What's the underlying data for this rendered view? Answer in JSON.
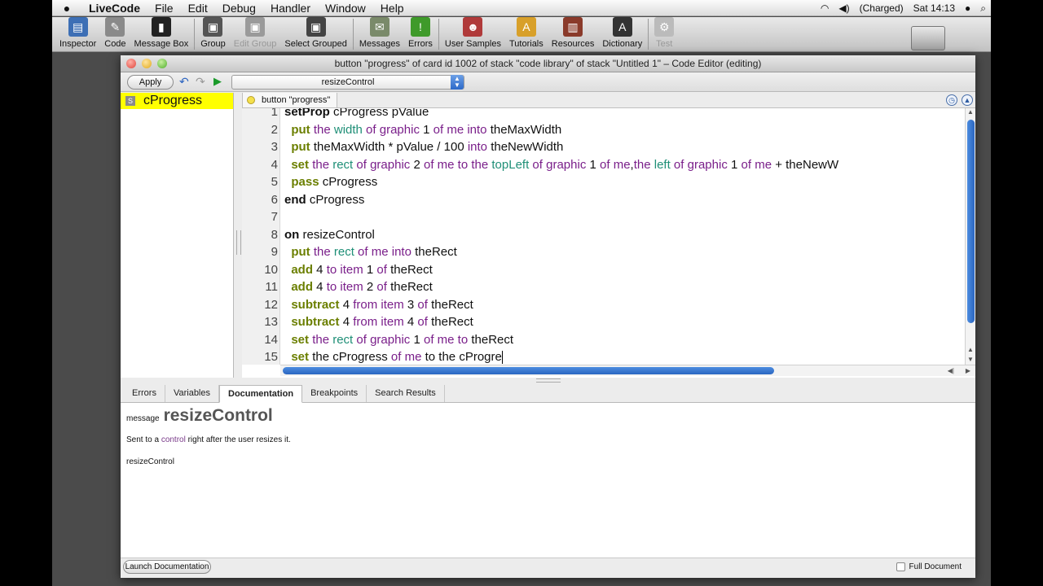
{
  "menubar": {
    "apple": "",
    "app_name": "LiveCode",
    "items": [
      "File",
      "Edit",
      "Debug",
      "Handler",
      "Window",
      "Help"
    ],
    "battery": "(Charged)",
    "clock": "Sat 14:13"
  },
  "toolbar": {
    "buttons": [
      {
        "label": "Inspector",
        "icon": "inspector-icon",
        "color": "#3d6fb5"
      },
      {
        "label": "Code",
        "icon": "code-icon",
        "color": "#8a8a8a"
      },
      {
        "label": "Message Box",
        "icon": "message-box-icon",
        "color": "#222222"
      },
      {
        "label": "Group",
        "icon": "group-icon",
        "color": "#555555"
      },
      {
        "label": "Edit Group",
        "icon": "edit-group-icon",
        "color": "#9a9a9a"
      },
      {
        "label": "Select Grouped",
        "icon": "select-grouped-icon",
        "color": "#444444"
      },
      {
        "label": "Messages",
        "icon": "messages-icon",
        "color": "#7a8a6a"
      },
      {
        "label": "Errors",
        "icon": "errors-icon",
        "color": "#3f9a2a"
      },
      {
        "label": "User Samples",
        "icon": "user-samples-icon",
        "color": "#b03a3a"
      },
      {
        "label": "Tutorials",
        "icon": "tutorials-icon",
        "color": "#d8a02a"
      },
      {
        "label": "Resources",
        "icon": "resources-icon",
        "color": "#8a3a2a"
      },
      {
        "label": "Dictionary",
        "icon": "dictionary-icon",
        "color": "#333333"
      },
      {
        "label": "Test",
        "icon": "test-icon",
        "color": "#bbbbbb"
      }
    ]
  },
  "window": {
    "title": "button \"progress\" of card id 1002 of stack \"code library\" of stack \"Untitled 1\" – Code Editor (editing)"
  },
  "editor": {
    "apply_label": "Apply",
    "handler_select": "resizeControl",
    "handlers": [
      {
        "badge": "S",
        "name": "cProgress"
      }
    ],
    "tab_label": "button \"progress\""
  },
  "code": {
    "line_numbers": [
      "1",
      "2",
      "3",
      "4",
      "5",
      "6",
      "7",
      "8",
      "9",
      "10",
      "11",
      "12",
      "13",
      "14",
      "15"
    ],
    "lines": [
      [
        {
          "t": "setProp",
          "c": "kwd"
        },
        {
          "t": " cProgress pValue",
          "c": ""
        }
      ],
      [
        {
          "t": "  ",
          "c": ""
        },
        {
          "t": "put",
          "c": "kw"
        },
        {
          "t": " the ",
          "c": "op"
        },
        {
          "t": "width",
          "c": "pr"
        },
        {
          "t": " of ",
          "c": "op"
        },
        {
          "t": "graphic",
          "c": "op"
        },
        {
          "t": " 1 ",
          "c": ""
        },
        {
          "t": "of",
          "c": "op"
        },
        {
          "t": " ",
          "c": ""
        },
        {
          "t": "me",
          "c": "op"
        },
        {
          "t": " ",
          "c": ""
        },
        {
          "t": "into",
          "c": "op"
        },
        {
          "t": " theMaxWidth",
          "c": ""
        }
      ],
      [
        {
          "t": "  ",
          "c": ""
        },
        {
          "t": "put",
          "c": "kw"
        },
        {
          "t": " theMaxWidth * pValue / 100 ",
          "c": ""
        },
        {
          "t": "into",
          "c": "op"
        },
        {
          "t": " theNewWidth",
          "c": ""
        }
      ],
      [
        {
          "t": "  ",
          "c": ""
        },
        {
          "t": "set",
          "c": "kw"
        },
        {
          "t": " the ",
          "c": "op"
        },
        {
          "t": "rect",
          "c": "pr"
        },
        {
          "t": " of ",
          "c": "op"
        },
        {
          "t": "graphic",
          "c": "op"
        },
        {
          "t": " 2 ",
          "c": ""
        },
        {
          "t": "of",
          "c": "op"
        },
        {
          "t": " ",
          "c": ""
        },
        {
          "t": "me",
          "c": "op"
        },
        {
          "t": " to the ",
          "c": "op"
        },
        {
          "t": "topLeft",
          "c": "pr"
        },
        {
          "t": " of ",
          "c": "op"
        },
        {
          "t": "graphic",
          "c": "op"
        },
        {
          "t": " 1 ",
          "c": ""
        },
        {
          "t": "of",
          "c": "op"
        },
        {
          "t": " ",
          "c": ""
        },
        {
          "t": "me",
          "c": "op"
        },
        {
          "t": ",",
          "c": ""
        },
        {
          "t": "the ",
          "c": "op"
        },
        {
          "t": "left",
          "c": "pr"
        },
        {
          "t": " of ",
          "c": "op"
        },
        {
          "t": "graphic",
          "c": "op"
        },
        {
          "t": " 1 ",
          "c": ""
        },
        {
          "t": "of",
          "c": "op"
        },
        {
          "t": " ",
          "c": ""
        },
        {
          "t": "me",
          "c": "op"
        },
        {
          "t": " + theNewW",
          "c": ""
        }
      ],
      [
        {
          "t": "  ",
          "c": ""
        },
        {
          "t": "pass",
          "c": "kw"
        },
        {
          "t": " cProgress",
          "c": ""
        }
      ],
      [
        {
          "t": "end",
          "c": "kwd"
        },
        {
          "t": " cProgress",
          "c": ""
        }
      ],
      [
        {
          "t": "",
          "c": ""
        }
      ],
      [
        {
          "t": "on",
          "c": "kwd"
        },
        {
          "t": " resizeControl",
          "c": ""
        }
      ],
      [
        {
          "t": "  ",
          "c": ""
        },
        {
          "t": "put",
          "c": "kw"
        },
        {
          "t": " the ",
          "c": "op"
        },
        {
          "t": "rect",
          "c": "pr"
        },
        {
          "t": " of ",
          "c": "op"
        },
        {
          "t": "me",
          "c": "op"
        },
        {
          "t": " ",
          "c": ""
        },
        {
          "t": "into",
          "c": "op"
        },
        {
          "t": " theRect",
          "c": ""
        }
      ],
      [
        {
          "t": "  ",
          "c": ""
        },
        {
          "t": "add",
          "c": "kw"
        },
        {
          "t": " 4 ",
          "c": ""
        },
        {
          "t": "to",
          "c": "op"
        },
        {
          "t": " ",
          "c": ""
        },
        {
          "t": "item",
          "c": "op"
        },
        {
          "t": " 1 ",
          "c": ""
        },
        {
          "t": "of",
          "c": "op"
        },
        {
          "t": " theRect",
          "c": ""
        }
      ],
      [
        {
          "t": "  ",
          "c": ""
        },
        {
          "t": "add",
          "c": "kw"
        },
        {
          "t": " 4 ",
          "c": ""
        },
        {
          "t": "to",
          "c": "op"
        },
        {
          "t": " ",
          "c": ""
        },
        {
          "t": "item",
          "c": "op"
        },
        {
          "t": " 2 ",
          "c": ""
        },
        {
          "t": "of",
          "c": "op"
        },
        {
          "t": " theRect",
          "c": ""
        }
      ],
      [
        {
          "t": "  ",
          "c": ""
        },
        {
          "t": "subtract",
          "c": "kw"
        },
        {
          "t": " 4 ",
          "c": ""
        },
        {
          "t": "from",
          "c": "op"
        },
        {
          "t": " ",
          "c": ""
        },
        {
          "t": "item",
          "c": "op"
        },
        {
          "t": " 3 ",
          "c": ""
        },
        {
          "t": "of",
          "c": "op"
        },
        {
          "t": " theRect",
          "c": ""
        }
      ],
      [
        {
          "t": "  ",
          "c": ""
        },
        {
          "t": "subtract",
          "c": "kw"
        },
        {
          "t": " 4 ",
          "c": ""
        },
        {
          "t": "from",
          "c": "op"
        },
        {
          "t": " ",
          "c": ""
        },
        {
          "t": "item",
          "c": "op"
        },
        {
          "t": " 4 ",
          "c": ""
        },
        {
          "t": "of",
          "c": "op"
        },
        {
          "t": " theRect",
          "c": ""
        }
      ],
      [
        {
          "t": "  ",
          "c": ""
        },
        {
          "t": "set",
          "c": "kw"
        },
        {
          "t": " the ",
          "c": "op"
        },
        {
          "t": "rect",
          "c": "pr"
        },
        {
          "t": " of ",
          "c": "op"
        },
        {
          "t": "graphic",
          "c": "op"
        },
        {
          "t": " 1 ",
          "c": ""
        },
        {
          "t": "of",
          "c": "op"
        },
        {
          "t": " ",
          "c": ""
        },
        {
          "t": "me",
          "c": "op"
        },
        {
          "t": " to ",
          "c": "op"
        },
        {
          "t": "theRect",
          "c": ""
        }
      ],
      [
        {
          "t": "  ",
          "c": ""
        },
        {
          "t": "set",
          "c": "kw"
        },
        {
          "t": " the cProgress ",
          "c": ""
        },
        {
          "t": "of",
          "c": "op"
        },
        {
          "t": " ",
          "c": ""
        },
        {
          "t": "me",
          "c": "op"
        },
        {
          "t": " to the cProgre",
          "c": ""
        }
      ]
    ]
  },
  "bottom_tabs": [
    "Errors",
    "Variables",
    "Documentation",
    "Breakpoints",
    "Search Results"
  ],
  "active_bottom_tab": "Documentation",
  "documentation": {
    "kind": "message",
    "title": "resizeControl",
    "desc_prefix": "Sent to a ",
    "desc_link": "control",
    "desc_suffix": " right after the user resizes it.",
    "syntax": "resizeControl"
  },
  "footer": {
    "launch_label": "Launch Documentation",
    "full_document_label": "Full Document"
  }
}
